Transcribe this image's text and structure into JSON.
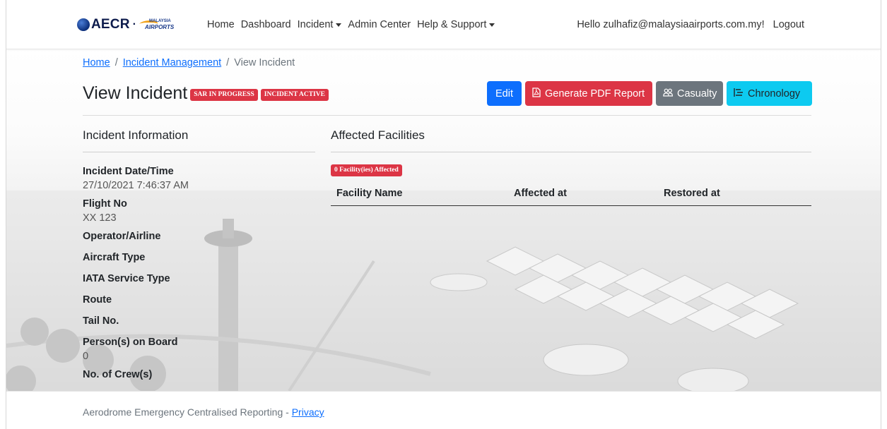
{
  "brand": {
    "name": "AECR",
    "separator": "·",
    "partner_logo_top": "MALAYSIA",
    "partner_logo_bottom": "AIRPORTS"
  },
  "nav": {
    "links": [
      "Home",
      "Dashboard",
      "Incident",
      "Admin Center",
      "Help & Support"
    ],
    "greeting": "Hello zulhafiz@malaysiaairports.com.my!",
    "logout": "Logout"
  },
  "breadcrumb": {
    "home": "Home",
    "incident_mgmt": "Incident Management",
    "current": "View Incident",
    "separator": "/"
  },
  "page": {
    "title": "View Incident",
    "badges": [
      "SAR IN PROGRESS",
      "INCIDENT ACTIVE"
    ]
  },
  "actions": {
    "edit": "Edit",
    "pdf": "Generate PDF Report",
    "casualty": "Casualty",
    "chronology": "Chronology"
  },
  "incident_info": {
    "title": "Incident Information",
    "fields": [
      {
        "label": "Incident Date/Time",
        "value": "27/10/2021 7:46:37 AM"
      },
      {
        "label": "Flight No",
        "value": "XX 123"
      },
      {
        "label": "Operator/Airline",
        "value": ""
      },
      {
        "label": "Aircraft Type",
        "value": ""
      },
      {
        "label": "IATA Service Type",
        "value": ""
      },
      {
        "label": "Route",
        "value": ""
      },
      {
        "label": "Tail No.",
        "value": ""
      },
      {
        "label": "Person(s) on Board",
        "value": "0"
      },
      {
        "label": "No. of Crew(s)",
        "value": ""
      }
    ]
  },
  "affected_facilities": {
    "title": "Affected Facilities",
    "count_badge": "0 Facility(ies) Affected",
    "columns": [
      "Facility Name",
      "Affected at",
      "Restored at"
    ]
  },
  "footer": {
    "text": "Aerodrome Emergency Centralised Reporting - ",
    "privacy": "Privacy"
  },
  "colors": {
    "primary": "#0d6efd",
    "danger": "#dc3545",
    "secondary": "#6c757d",
    "info": "#0dcaf0"
  }
}
